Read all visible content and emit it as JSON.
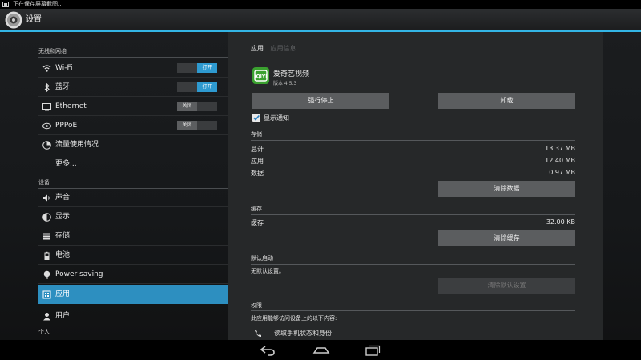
{
  "status_bar": {
    "notification": "正在保存屏幕截图..."
  },
  "action_bar": {
    "title": "设置"
  },
  "sidebar": {
    "wireless_header": "无线和网络",
    "device_header": "设备",
    "personal_header": "个人",
    "items": [
      {
        "label": "Wi-Fi",
        "icon": "wifi-icon",
        "toggle": "打开",
        "toggle_state": "on"
      },
      {
        "label": "蓝牙",
        "icon": "bluetooth-icon",
        "toggle": "打开",
        "toggle_state": "on"
      },
      {
        "label": "Ethernet",
        "icon": "ethernet-icon",
        "toggle": "关闭",
        "toggle_state": "off"
      },
      {
        "label": "PPPoE",
        "icon": "pppoe-icon",
        "toggle": "关闭",
        "toggle_state": "off"
      },
      {
        "label": "流量使用情况",
        "icon": "data-usage-icon"
      },
      {
        "label": "更多..."
      },
      {
        "label": "声音",
        "icon": "sound-icon"
      },
      {
        "label": "显示",
        "icon": "display-icon"
      },
      {
        "label": "存储",
        "icon": "storage-icon"
      },
      {
        "label": "电池",
        "icon": "battery-icon"
      },
      {
        "label": "Power saving",
        "icon": "power-saving-icon"
      },
      {
        "label": "应用",
        "icon": "apps-icon",
        "selected": true
      },
      {
        "label": "用户",
        "icon": "users-icon"
      }
    ]
  },
  "app_info": {
    "tab_active": "应用",
    "tab_inactive": "应用信息",
    "app_name": "爱奇艺视频",
    "version": "版本 4.5.3",
    "force_stop": "强行停止",
    "uninstall": "卸载",
    "show_notifications": "显示通知",
    "storage": {
      "header": "存储",
      "rows": [
        {
          "label": "总计",
          "value": "13.37 MB"
        },
        {
          "label": "应用",
          "value": "12.40 MB"
        },
        {
          "label": "数据",
          "value": "0.97 MB"
        }
      ],
      "clear_data": "清除数据"
    },
    "cache": {
      "header": "缓存",
      "label": "缓存",
      "value": "32.00 KB",
      "clear_cache": "清除缓存"
    },
    "launch_default": {
      "header": "默认启动",
      "text": "无默认设置。",
      "clear_defaults": "清除默认设置"
    },
    "permissions": {
      "header": "权限",
      "text": "此应用能够访问设备上的以下内容:",
      "item": "读取手机状态和身份"
    }
  },
  "colors": {
    "accent": "#33b5e5",
    "selected": "#2d8fc0",
    "app_green": "#3aa12f"
  }
}
